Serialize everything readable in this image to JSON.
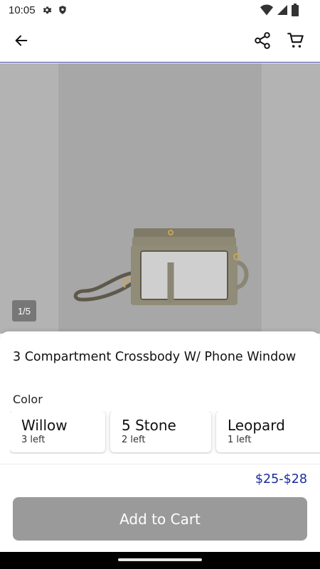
{
  "status_bar": {
    "time": "10:05",
    "left_icons": [
      "gear-icon",
      "shield-icon"
    ],
    "right_icons": [
      "wifi-icon",
      "cellular-icon",
      "battery-icon"
    ]
  },
  "app_bar": {
    "back_icon": "arrow-left-icon",
    "share_icon": "share-icon",
    "cart_icon": "cart-icon"
  },
  "gallery": {
    "indicator": "1/5",
    "current_image": 1,
    "total_images": 5
  },
  "product": {
    "title": "3 Compartment Crossbody W/ Phone Window",
    "color_label": "Color",
    "colors": [
      {
        "name": "Willow",
        "stock": "3 left"
      },
      {
        "name": "5 Stone",
        "stock": "2 left"
      },
      {
        "name": "Leopard",
        "stock": "1 left"
      }
    ],
    "price": "$25-$28",
    "add_to_cart_label": "Add to Cart"
  },
  "colors": {
    "accent": "#1a2b9b",
    "button_disabled": "#9a9a9a",
    "image_background": "#b3b3b3",
    "bag": "#8a8570"
  }
}
